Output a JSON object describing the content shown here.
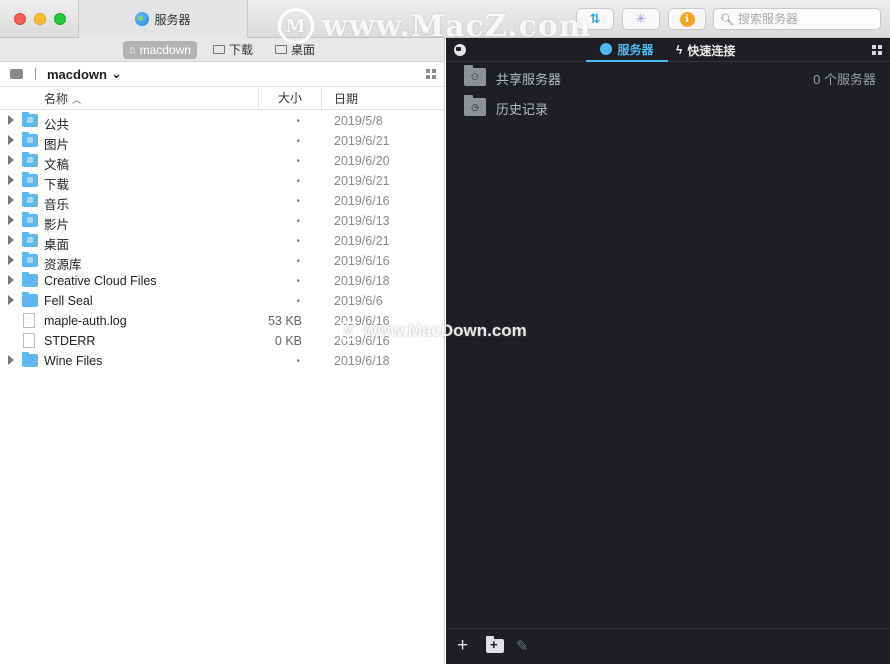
{
  "window": {
    "tab_title": "服务器",
    "search_placeholder": "搜索服务器"
  },
  "toolbar": {
    "sync_glyph": "⇅",
    "activity_glyph": "✳",
    "info_glyph": "i"
  },
  "left_pane": {
    "breadcrumbs": [
      {
        "label": "macdown",
        "active": true
      },
      {
        "label": "下载",
        "active": false
      },
      {
        "label": "桌面",
        "active": false
      }
    ],
    "current_path": "macdown",
    "columns": {
      "name": "名称",
      "size": "大小",
      "date": "日期"
    },
    "files": [
      {
        "name": "公共",
        "size": "•",
        "date": "2019/5/8",
        "kind": "folder"
      },
      {
        "name": "图片",
        "size": "•",
        "date": "2019/6/21",
        "kind": "folder"
      },
      {
        "name": "文稿",
        "size": "•",
        "date": "2019/6/20",
        "kind": "folder"
      },
      {
        "name": "下载",
        "size": "•",
        "date": "2019/6/21",
        "kind": "folder"
      },
      {
        "name": "音乐",
        "size": "•",
        "date": "2019/6/16",
        "kind": "folder"
      },
      {
        "name": "影片",
        "size": "•",
        "date": "2019/6/13",
        "kind": "folder"
      },
      {
        "name": "桌面",
        "size": "•",
        "date": "2019/6/21",
        "kind": "folder"
      },
      {
        "name": "资源库",
        "size": "•",
        "date": "2019/6/16",
        "kind": "folder"
      },
      {
        "name": "Creative Cloud Files",
        "size": "•",
        "date": "2019/6/18",
        "kind": "folder"
      },
      {
        "name": "Fell Seal",
        "size": "•",
        "date": "2019/6/6",
        "kind": "folder"
      },
      {
        "name": "maple-auth.log",
        "size": "53 KB",
        "date": "2019/6/16",
        "kind": "file"
      },
      {
        "name": "STDERR",
        "size": "0 KB",
        "date": "2019/6/16",
        "kind": "file"
      },
      {
        "name": "Wine Files",
        "size": "•",
        "date": "2019/6/18",
        "kind": "folder"
      }
    ]
  },
  "right_pane": {
    "tabs": {
      "servers": "服务器",
      "quick_connect": "快速连接"
    },
    "items": [
      {
        "name": "共享服务器",
        "count": "0 个服务器"
      },
      {
        "name": "历史记录",
        "count": ""
      }
    ]
  },
  "watermarks": {
    "top": "www.MacZ.com",
    "middle": "www.MacDown.com",
    "logo_letter": "M"
  },
  "colors": {
    "accent": "#4fb8f0",
    "folder": "#5fb6f0",
    "dark_bg": "#1d1f24",
    "info": "#f5a623"
  }
}
